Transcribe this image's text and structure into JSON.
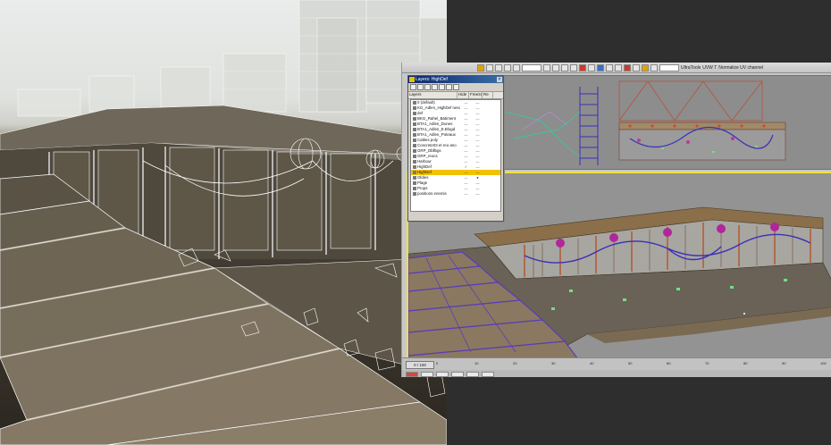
{
  "render": {
    "description_colors": {
      "sky": "#e6e9e6",
      "concrete": "#6b6152",
      "wire": "#ffffff"
    }
  },
  "app": {
    "toolbar_fields": [
      "",
      ""
    ],
    "toolbar_labels": [
      "UltraTools",
      "UVW T",
      "Normalize UV channel"
    ],
    "accent": "#f0e23a"
  },
  "layers_dialog": {
    "title": "Layers: HighDef",
    "columns": {
      "name": "Layers",
      "hide": "Hide",
      "freeze": "Freeze",
      "render": "Re"
    },
    "rows": [
      {
        "name": "0 (default)",
        "icon": "layer-icon",
        "hide": "—",
        "freeze": "—",
        "selected": false
      },
      {
        "name": "KG_Adlen_HighDef nesche",
        "icon": "layer-icon",
        "hide": "—",
        "freeze": "—",
        "selected": false
      },
      {
        "name": "def",
        "icon": "layer-icon",
        "hide": "—",
        "freeze": "—",
        "selected": false
      },
      {
        "name": "BKG_Rahel_Batiment",
        "icon": "layer-icon",
        "hide": "—",
        "freeze": "—",
        "selected": false
      },
      {
        "name": "BTA1_Adlen_Dunes",
        "icon": "layer-icon",
        "hide": "—",
        "freeze": "—",
        "selected": false
      },
      {
        "name": "BTA1_Adlen_E.Blogd",
        "icon": "layer-icon",
        "hide": "—",
        "freeze": "—",
        "selected": false
      },
      {
        "name": "BTA1_Adlen_Poteaux",
        "icon": "layer-icon",
        "hide": "—",
        "freeze": "—",
        "selected": false
      },
      {
        "name": "Cables poly",
        "icon": "layer-icon",
        "hide": "—",
        "freeze": "—",
        "selected": false
      },
      {
        "name": "Concrete03 et reo ano",
        "icon": "layer-icon",
        "hide": "—",
        "freeze": "—",
        "selected": false
      },
      {
        "name": "GRP_Dbllbgs",
        "icon": "layer-icon",
        "hide": "—",
        "freeze": "—",
        "selected": false
      },
      {
        "name": "GRP_reocs",
        "icon": "layer-icon",
        "hide": "—",
        "freeze": "—",
        "selected": false
      },
      {
        "name": "Harbour",
        "icon": "layer-icon",
        "hide": "—",
        "freeze": "—",
        "selected": false
      },
      {
        "name": "HighDef",
        "icon": "layer-icon",
        "hide": "✓",
        "freeze": "—",
        "selected": false
      },
      {
        "name": "HighDef",
        "icon": "layer-icon",
        "hide": "—",
        "freeze": "—",
        "selected": true
      },
      {
        "name": "Oldies",
        "icon": "layer-icon",
        "hide": "—",
        "freeze": "●",
        "selected": false
      },
      {
        "name": "Plage",
        "icon": "layer-icon",
        "hide": "—",
        "freeze": "—",
        "selected": false
      },
      {
        "name": "Props",
        "icon": "layer-icon",
        "hide": "—",
        "freeze": "—",
        "selected": false
      },
      {
        "name": "positions enemis",
        "icon": "layer-icon",
        "hide": "—",
        "freeze": "—",
        "selected": false
      }
    ]
  },
  "timeline": {
    "frame_display": "0 / 100",
    "ticks": [
      "0",
      "10",
      "20",
      "30",
      "40",
      "50",
      "60",
      "70",
      "80",
      "90",
      "100"
    ]
  }
}
